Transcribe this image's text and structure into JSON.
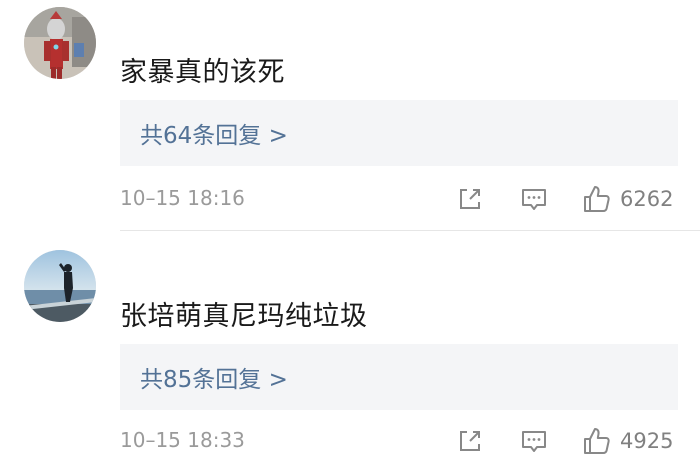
{
  "comments": [
    {
      "text": "家暴真的该死",
      "replies_label": "共64条回复 >",
      "time": "10–15 18:16",
      "likes": "6262",
      "avatar": "ultraman-figure-avatar"
    },
    {
      "text": "张培萌真尼玛纯垃圾",
      "replies_label": "共85条回复 >",
      "time": "10–15 18:33",
      "likes": "4925",
      "avatar": "seaside-person-avatar"
    }
  ],
  "icons": {
    "share": "share-icon",
    "comment": "comment-icon",
    "like": "thumbs-up-icon"
  },
  "colors": {
    "link": "#537296",
    "reply_bg": "#f4f5f7",
    "meta": "#9a9a9a"
  }
}
